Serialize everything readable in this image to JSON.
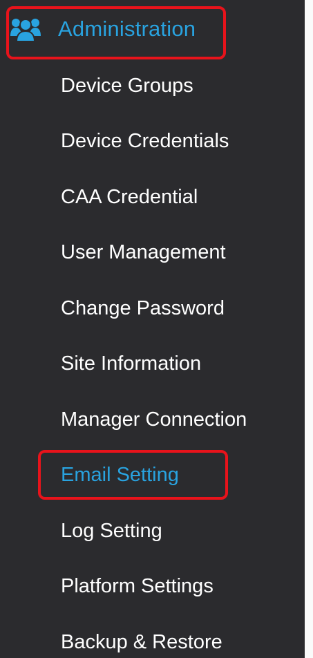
{
  "colors": {
    "background": "#2b2b2e",
    "text": "#ffffff",
    "active": "#29a3e0",
    "highlight": "#e8131b"
  },
  "header": {
    "label": "Administration",
    "icon": "users-icon"
  },
  "nav": {
    "active": "Email Setting",
    "items": [
      {
        "label": "Device Groups"
      },
      {
        "label": "Device Credentials"
      },
      {
        "label": "CAA Credential"
      },
      {
        "label": "User Management"
      },
      {
        "label": "Change Password"
      },
      {
        "label": "Site Information"
      },
      {
        "label": "Manager Connection"
      },
      {
        "label": "Email Setting"
      },
      {
        "label": "Log Setting"
      },
      {
        "label": "Platform Settings"
      },
      {
        "label": "Backup & Restore"
      }
    ]
  }
}
